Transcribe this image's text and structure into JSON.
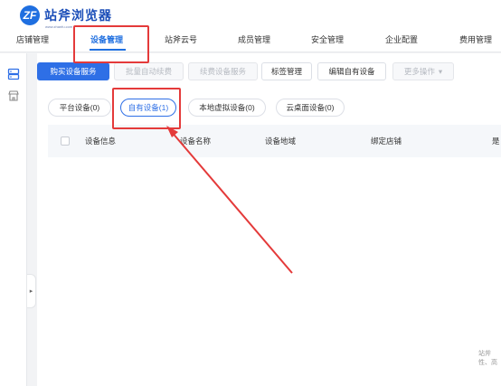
{
  "app": {
    "logo_mark": "ZF",
    "logo_text": "站斧浏览器",
    "logo_sub": "www.zhanfu.com"
  },
  "topnav": {
    "items": [
      {
        "label": "店铺管理"
      },
      {
        "label": "设备管理"
      },
      {
        "label": "站斧云号"
      },
      {
        "label": "成员管理"
      },
      {
        "label": "安全管理"
      },
      {
        "label": "企业配置"
      },
      {
        "label": "费用管理"
      }
    ],
    "active_index": 1
  },
  "toolbar": {
    "buy": "购买设备服务",
    "batch_renew": "批量自动续费",
    "renew": "续费设备服务",
    "tags": "标签管理",
    "edit_own": "编辑自有设备",
    "more": "更多操作",
    "more_caret": "▾"
  },
  "filters": {
    "platform": "平台设备(0)",
    "own": "自有设备(1)",
    "local_virtual": "本地虚拟设备(0)",
    "cloud_desktop": "云桌面设备(0)"
  },
  "table": {
    "headers": [
      "设备信息",
      "设备名称",
      "设备地域",
      "绑定店铺",
      "是"
    ]
  },
  "footer": {
    "line1": "站斧",
    "line2": "性、高"
  },
  "colors": {
    "accent": "#2e6fe6",
    "annotation": "#e43a3a"
  }
}
